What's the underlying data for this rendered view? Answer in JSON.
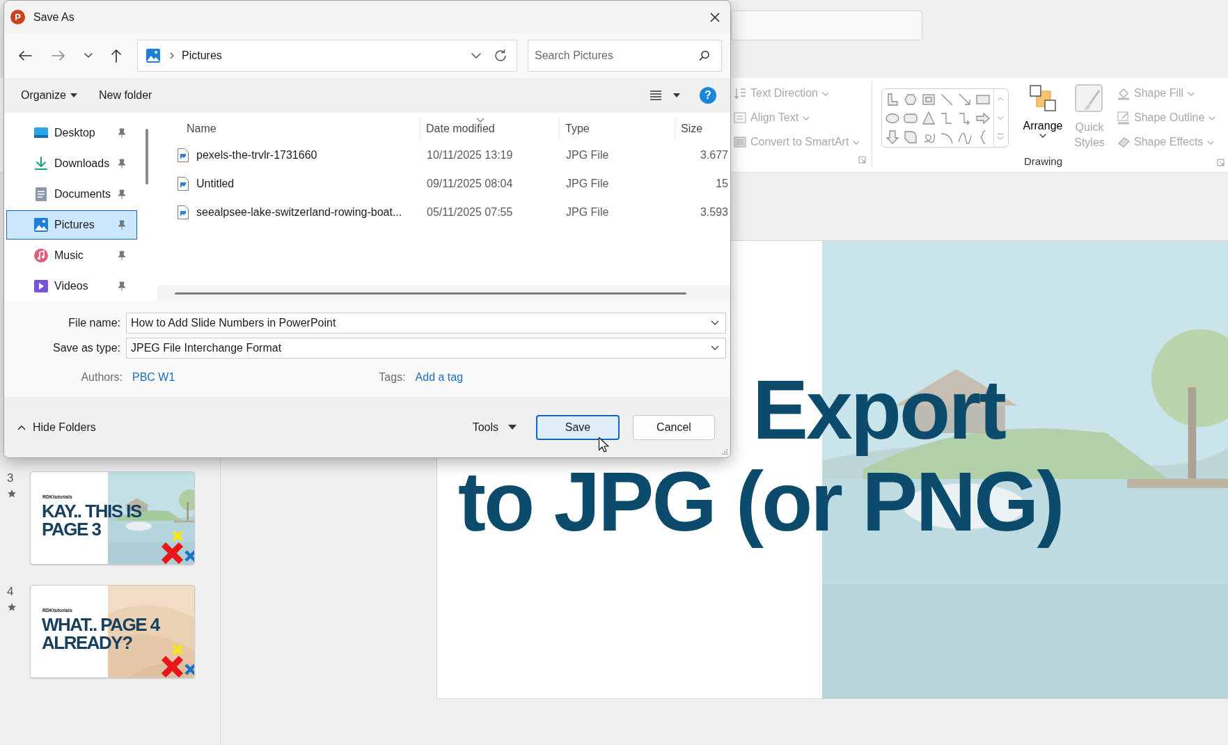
{
  "dialog": {
    "logo": "P",
    "title": "Save As",
    "address": "Pictures",
    "search_placeholder": "Search Pictures",
    "toolbar": {
      "organize": "Organize",
      "new_folder": "New folder",
      "help": "?"
    },
    "nav": [
      {
        "label": "Desktop",
        "selected": false
      },
      {
        "label": "Downloads",
        "selected": false
      },
      {
        "label": "Documents",
        "selected": false
      },
      {
        "label": "Pictures",
        "selected": true
      },
      {
        "label": "Music",
        "selected": false
      },
      {
        "label": "Videos",
        "selected": false
      }
    ],
    "columns": [
      "Name",
      "Date modified",
      "Type",
      "Size"
    ],
    "files": [
      {
        "name": "pexels-the-trvlr-1731660",
        "date": "10/11/2025 13:19",
        "type": "JPG File",
        "size": "3.677"
      },
      {
        "name": "Untitled",
        "date": "09/11/2025 08:04",
        "type": "JPG File",
        "size": "15"
      },
      {
        "name": "seealpsee-lake-switzerland-rowing-boat...",
        "date": "05/11/2025 07:55",
        "type": "JPG File",
        "size": "3.593"
      }
    ],
    "fields": [
      {
        "label": "File name:",
        "value": "How to Add Slide Numbers in PowerPoint"
      },
      {
        "label": "Save as type:",
        "value": "JPEG File Interchange Format"
      }
    ],
    "authors": {
      "label": "Authors:",
      "value": "PBC W1"
    },
    "tags": {
      "label": "Tags:",
      "value": "Add a tag"
    },
    "hide_folders": "Hide Folders",
    "tools": "Tools",
    "buttons": [
      {
        "label": "Save",
        "kind": "default"
      },
      {
        "label": "Cancel",
        "kind": "normal"
      }
    ]
  },
  "ribbon": {
    "text_commands": [
      {
        "label": "Text Direction",
        "disabled": true
      },
      {
        "label": "Align Text",
        "disabled": true
      },
      {
        "label": "Convert to SmartArt",
        "disabled": true
      }
    ],
    "arrange": {
      "label": "Arrange",
      "disabled": false
    },
    "quick_styles": {
      "label": "Quick Styles",
      "disabled": true
    },
    "shape_format": [
      {
        "label": "Shape Fill",
        "disabled": true
      },
      {
        "label": "Shape Outline",
        "disabled": true
      },
      {
        "label": "Shape Effects",
        "disabled": true
      }
    ],
    "group_label": "Drawing"
  },
  "slides": [
    {
      "number": "3",
      "brand": "RDKtutorials",
      "title": "KAY.. THIS IS\nPAGE 3"
    },
    {
      "number": "4",
      "brand": "RDKtutorials",
      "title": "WHAT.. PAGE 4\nALREADY?"
    }
  ],
  "slide": {
    "title_lines": [
      "Export",
      "to JPG (or PNG)"
    ]
  }
}
